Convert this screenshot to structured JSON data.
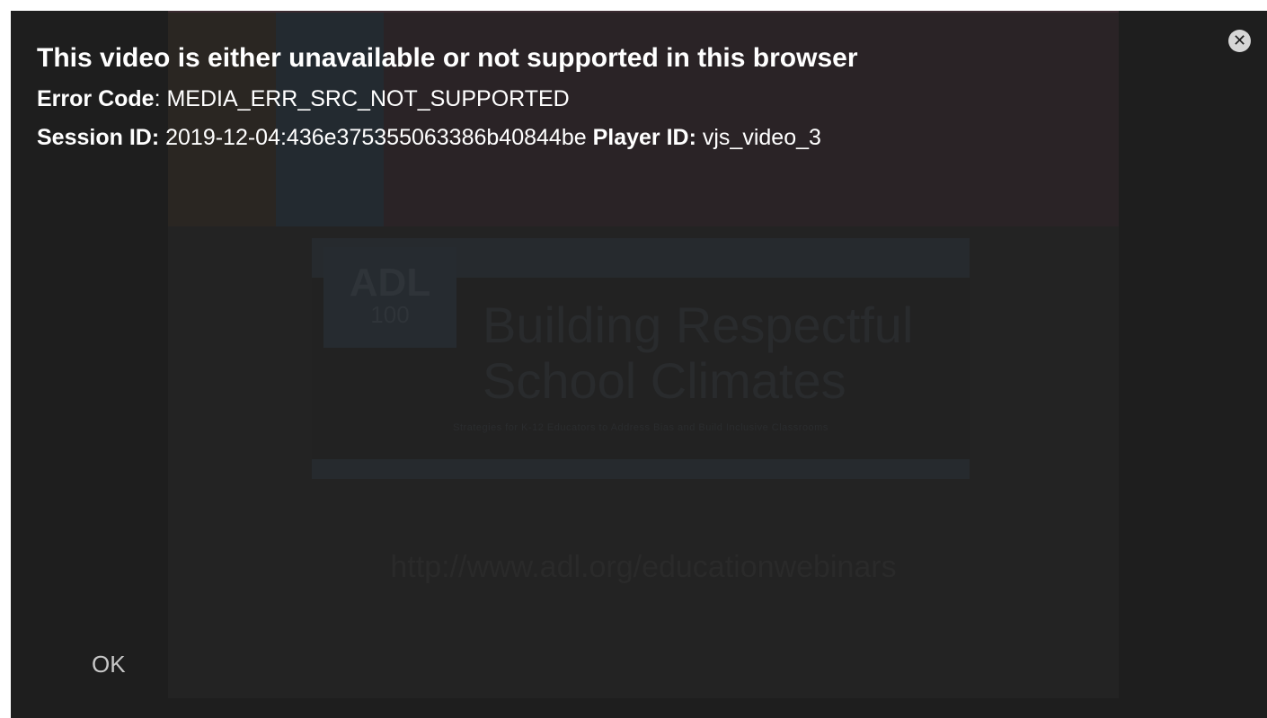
{
  "poster": {
    "logo_main": "ADL",
    "logo_sub": "100",
    "title": "Building Respectful School Climates",
    "tagline": "Strategies for K-12 Educators to Address Bias and Build Inclusive Classrooms",
    "url": "http://www.adl.org/educationwebinars"
  },
  "error": {
    "title": "This video is either unavailable or not supported in this browser",
    "code_label": "Error Code",
    "code_value": ": MEDIA_ERR_SRC_NOT_SUPPORTED",
    "session_label": "Session ID:",
    "session_value": " 2019-12-04:436e375355063386b40844be ",
    "player_label": "Player ID:",
    "player_value": " vjs_video_3"
  },
  "controls": {
    "close_glyph": "✕",
    "ok_label": "OK"
  },
  "colors": {
    "overlay_bg": "#1e1e1e",
    "text": "#ffffff",
    "close_bg": "#d6d6d6"
  }
}
